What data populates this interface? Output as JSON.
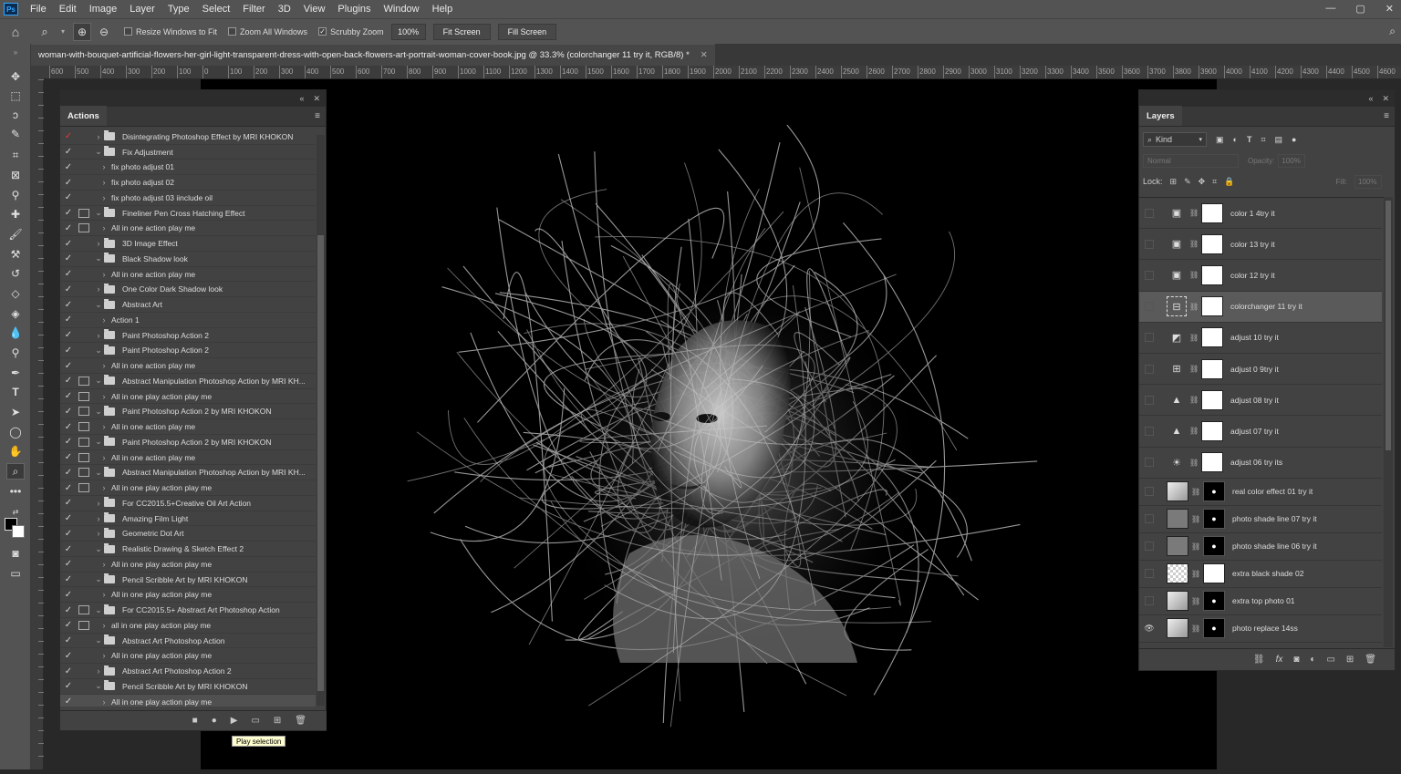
{
  "app": {
    "logo": "Ps"
  },
  "menu": [
    "File",
    "Edit",
    "Image",
    "Layer",
    "Type",
    "Select",
    "Filter",
    "3D",
    "View",
    "Plugins",
    "Window",
    "Help"
  ],
  "window_controls": {
    "minimize": "—",
    "maximize": "▢",
    "close": "✕"
  },
  "options": {
    "zoom_pct": "100%",
    "resize_windows": "Resize Windows to Fit",
    "zoom_all": "Zoom All Windows",
    "scrubby": "Scrubby Zoom",
    "scrubby_checked": "✓",
    "fit_screen": "Fit Screen",
    "fill_screen": "Fill Screen"
  },
  "document": {
    "tab_title": "woman-with-bouquet-artificial-flowers-her-girl-light-transparent-dress-with-open-back-flowers-art-portrait-woman-cover-book.jpg @ 33.3% (colorchanger 11 try it, RGB/8) *",
    "close": "✕"
  },
  "ruler_labels": [
    "600",
    "500",
    "400",
    "300",
    "200",
    "100",
    "0",
    "100",
    "200",
    "300",
    "400",
    "500",
    "600",
    "700",
    "800",
    "900",
    "1000",
    "1100",
    "1200",
    "1300",
    "1400",
    "1500",
    "1600",
    "1700",
    "1800",
    "1900",
    "2000",
    "2100",
    "2200",
    "2300",
    "2400",
    "2500",
    "2600",
    "2700",
    "2800",
    "2900",
    "3000",
    "3100",
    "3200",
    "3300",
    "3400",
    "3500",
    "3600",
    "3700",
    "3800",
    "3900",
    "4000",
    "4100",
    "4200",
    "4300",
    "4400",
    "4500",
    "4600"
  ],
  "actions_panel": {
    "title": "Actions",
    "menu_icon": "≡",
    "collapse": "«",
    "close": "✕",
    "rows": [
      {
        "label": "Disintegrating Photoshop Effect by MRI KHOKON",
        "kind": "set",
        "expanded": false,
        "dialog": false,
        "check": "✓",
        "red": true
      },
      {
        "label": "Fix Adjustment",
        "kind": "set",
        "expanded": true,
        "dialog": false,
        "check": "✓"
      },
      {
        "label": "fix photo adjust 01",
        "kind": "action",
        "dialog": false,
        "check": "✓"
      },
      {
        "label": "fix photo adjust 02",
        "kind": "action",
        "dialog": false,
        "check": "✓"
      },
      {
        "label": "fix photo adjust 03 iinclude oil",
        "kind": "action",
        "dialog": false,
        "check": "✓"
      },
      {
        "label": "Fineliner Pen Cross Hatching Effect",
        "kind": "set",
        "expanded": true,
        "dialog": true,
        "check": "✓"
      },
      {
        "label": "All in one action play me",
        "kind": "action",
        "dialog": true,
        "check": "✓"
      },
      {
        "label": "3D Image Effect",
        "kind": "set",
        "expanded": false,
        "dialog": false,
        "check": "✓"
      },
      {
        "label": "Black Shadow look",
        "kind": "set",
        "expanded": true,
        "dialog": false,
        "check": "✓"
      },
      {
        "label": "All in one action play me",
        "kind": "action",
        "dialog": false,
        "check": "✓"
      },
      {
        "label": "One Color Dark Shadow look",
        "kind": "set",
        "expanded": false,
        "dialog": false,
        "check": "✓"
      },
      {
        "label": "Abstract Art",
        "kind": "set",
        "expanded": true,
        "dialog": false,
        "check": "✓"
      },
      {
        "label": "Action 1",
        "kind": "action",
        "dialog": false,
        "check": "✓"
      },
      {
        "label": "Paint Photoshop Action 2",
        "kind": "set",
        "expanded": false,
        "dialog": false,
        "check": "✓"
      },
      {
        "label": "Paint Photoshop Action 2",
        "kind": "set",
        "expanded": true,
        "dialog": false,
        "check": "✓"
      },
      {
        "label": "All in one action play me",
        "kind": "action",
        "dialog": false,
        "check": "✓"
      },
      {
        "label": "Abstract Manipulation Photoshop Action by MRI KH...",
        "kind": "set",
        "expanded": true,
        "dialog": true,
        "check": "✓"
      },
      {
        "label": "All in one play action play me",
        "kind": "action",
        "dialog": true,
        "check": "✓"
      },
      {
        "label": "Paint Photoshop Action 2 by MRI KHOKON",
        "kind": "set",
        "expanded": true,
        "dialog": true,
        "check": "✓"
      },
      {
        "label": "All in one action play me",
        "kind": "action",
        "dialog": true,
        "check": "✓"
      },
      {
        "label": "Paint Photoshop Action 2 by MRI KHOKON",
        "kind": "set",
        "expanded": true,
        "dialog": true,
        "check": "✓"
      },
      {
        "label": "All in one action play me",
        "kind": "action",
        "dialog": true,
        "check": "✓"
      },
      {
        "label": "Abstract Manipulation Photoshop Action by MRI KH...",
        "kind": "set",
        "expanded": true,
        "dialog": true,
        "check": "✓"
      },
      {
        "label": "All in one play action play me",
        "kind": "action",
        "dialog": true,
        "check": "✓"
      },
      {
        "label": "For CC2015.5+Creative Oil Art Action",
        "kind": "set",
        "expanded": false,
        "dialog": false,
        "check": "✓"
      },
      {
        "label": "Amazing Film Light",
        "kind": "set",
        "expanded": false,
        "dialog": false,
        "check": "✓"
      },
      {
        "label": "Geometric Dot Art",
        "kind": "set",
        "expanded": false,
        "dialog": false,
        "check": "✓"
      },
      {
        "label": "Realistic Drawing & Sketch Effect 2",
        "kind": "set",
        "expanded": true,
        "dialog": false,
        "check": "✓"
      },
      {
        "label": "All in one play action play me",
        "kind": "action",
        "dialog": false,
        "check": "✓"
      },
      {
        "label": "Pencil Scribble Art by MRI KHOKON",
        "kind": "set",
        "expanded": true,
        "dialog": false,
        "check": "✓"
      },
      {
        "label": "All in one play action play me",
        "kind": "action",
        "dialog": false,
        "check": "✓"
      },
      {
        "label": "For CC2015.5+ Abstract Art Photoshop Action",
        "kind": "set",
        "expanded": true,
        "dialog": true,
        "check": "✓"
      },
      {
        "label": "all in one play action play me",
        "kind": "action",
        "dialog": true,
        "check": "✓"
      },
      {
        "label": "Abstract Art Photoshop Action",
        "kind": "set",
        "expanded": true,
        "dialog": false,
        "check": "✓"
      },
      {
        "label": "All in one play action play me",
        "kind": "action",
        "dialog": false,
        "check": "✓"
      },
      {
        "label": "Abstract Art Photoshop Action 2",
        "kind": "set",
        "expanded": false,
        "dialog": false,
        "check": "✓"
      },
      {
        "label": "Pencil Scribble Art by MRI KHOKON",
        "kind": "set",
        "expanded": true,
        "dialog": false,
        "check": "✓"
      },
      {
        "label": "All in one play action play me",
        "kind": "action",
        "dialog": false,
        "check": "✓",
        "selected": true
      }
    ],
    "bottom_icons": {
      "stop": "■",
      "record": "●",
      "play": "▶",
      "new_set": "▭",
      "new_action": "⊞",
      "delete": "🗑"
    },
    "tooltip": "Play selection"
  },
  "layers_panel": {
    "title": "Layers",
    "menu_icon": "≡",
    "collapse": "«",
    "close": "✕",
    "filter_kind": "Kind",
    "blend_mode": "Normal",
    "opacity_label": "Opacity:",
    "opacity_value": "100%",
    "lock_label": "Lock:",
    "fill_label": "Fill:",
    "fill_value": "100%",
    "layers": [
      {
        "name": "color 1 4try it",
        "thumb": "adj-gradient",
        "mask": "white",
        "visible": false
      },
      {
        "name": "color 13 try it",
        "thumb": "adj-gradient",
        "mask": "white",
        "visible": false
      },
      {
        "name": "color 12 try it",
        "thumb": "adj-gradient",
        "mask": "white",
        "visible": false
      },
      {
        "name": "colorchanger 11 try it",
        "thumb": "adj-mixer",
        "mask": "white",
        "visible": false,
        "selected": true
      },
      {
        "name": "adjust 10 try it",
        "thumb": "adj-curves",
        "mask": "white",
        "visible": false
      },
      {
        "name": "adjust 0 9try it",
        "thumb": "adj-table",
        "mask": "white",
        "visible": false
      },
      {
        "name": "adjust 08 try it",
        "thumb": "adj-levels",
        "mask": "white",
        "visible": false
      },
      {
        "name": "adjust 07 try it",
        "thumb": "adj-levels",
        "mask": "white",
        "visible": false
      },
      {
        "name": "adjust 06 try its",
        "thumb": "adj-brightness",
        "mask": "white",
        "visible": false
      },
      {
        "name": "real color effect 01 try it",
        "thumb": "photo",
        "mask": "black",
        "visible": false
      },
      {
        "name": "photo shade line 07 try it",
        "thumb": "gray",
        "mask": "black",
        "visible": false
      },
      {
        "name": "photo shade line 06 try it",
        "thumb": "gray",
        "mask": "black",
        "visible": false
      },
      {
        "name": "extra black shade 02",
        "thumb": "checker",
        "mask": "white",
        "visible": false
      },
      {
        "name": "extra top photo 01",
        "thumb": "photo",
        "mask": "black",
        "visible": false
      },
      {
        "name": "photo replace 14ss",
        "thumb": "photo",
        "mask": "black",
        "visible": true
      }
    ],
    "bottom_icons": {
      "link": "⛓",
      "fx": "fx",
      "mask": "◙",
      "adjust": "◐",
      "group": "▭",
      "new": "⊞",
      "delete": "🗑"
    }
  }
}
